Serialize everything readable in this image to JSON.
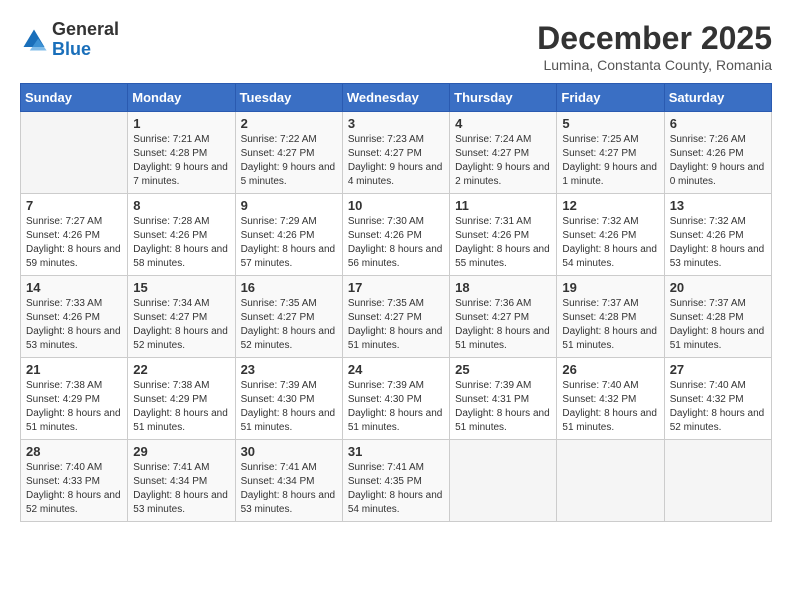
{
  "header": {
    "logo": {
      "general": "General",
      "blue": "Blue"
    },
    "title": "December 2025",
    "location": "Lumina, Constanta County, Romania"
  },
  "calendar": {
    "days_of_week": [
      "Sunday",
      "Monday",
      "Tuesday",
      "Wednesday",
      "Thursday",
      "Friday",
      "Saturday"
    ],
    "weeks": [
      [
        {
          "day": "",
          "sunrise": "",
          "sunset": "",
          "daylight": ""
        },
        {
          "day": "1",
          "sunrise": "Sunrise: 7:21 AM",
          "sunset": "Sunset: 4:28 PM",
          "daylight": "Daylight: 9 hours and 7 minutes."
        },
        {
          "day": "2",
          "sunrise": "Sunrise: 7:22 AM",
          "sunset": "Sunset: 4:27 PM",
          "daylight": "Daylight: 9 hours and 5 minutes."
        },
        {
          "day": "3",
          "sunrise": "Sunrise: 7:23 AM",
          "sunset": "Sunset: 4:27 PM",
          "daylight": "Daylight: 9 hours and 4 minutes."
        },
        {
          "day": "4",
          "sunrise": "Sunrise: 7:24 AM",
          "sunset": "Sunset: 4:27 PM",
          "daylight": "Daylight: 9 hours and 2 minutes."
        },
        {
          "day": "5",
          "sunrise": "Sunrise: 7:25 AM",
          "sunset": "Sunset: 4:27 PM",
          "daylight": "Daylight: 9 hours and 1 minute."
        },
        {
          "day": "6",
          "sunrise": "Sunrise: 7:26 AM",
          "sunset": "Sunset: 4:26 PM",
          "daylight": "Daylight: 9 hours and 0 minutes."
        }
      ],
      [
        {
          "day": "7",
          "sunrise": "Sunrise: 7:27 AM",
          "sunset": "Sunset: 4:26 PM",
          "daylight": "Daylight: 8 hours and 59 minutes."
        },
        {
          "day": "8",
          "sunrise": "Sunrise: 7:28 AM",
          "sunset": "Sunset: 4:26 PM",
          "daylight": "Daylight: 8 hours and 58 minutes."
        },
        {
          "day": "9",
          "sunrise": "Sunrise: 7:29 AM",
          "sunset": "Sunset: 4:26 PM",
          "daylight": "Daylight: 8 hours and 57 minutes."
        },
        {
          "day": "10",
          "sunrise": "Sunrise: 7:30 AM",
          "sunset": "Sunset: 4:26 PM",
          "daylight": "Daylight: 8 hours and 56 minutes."
        },
        {
          "day": "11",
          "sunrise": "Sunrise: 7:31 AM",
          "sunset": "Sunset: 4:26 PM",
          "daylight": "Daylight: 8 hours and 55 minutes."
        },
        {
          "day": "12",
          "sunrise": "Sunrise: 7:32 AM",
          "sunset": "Sunset: 4:26 PM",
          "daylight": "Daylight: 8 hours and 54 minutes."
        },
        {
          "day": "13",
          "sunrise": "Sunrise: 7:32 AM",
          "sunset": "Sunset: 4:26 PM",
          "daylight": "Daylight: 8 hours and 53 minutes."
        }
      ],
      [
        {
          "day": "14",
          "sunrise": "Sunrise: 7:33 AM",
          "sunset": "Sunset: 4:26 PM",
          "daylight": "Daylight: 8 hours and 53 minutes."
        },
        {
          "day": "15",
          "sunrise": "Sunrise: 7:34 AM",
          "sunset": "Sunset: 4:27 PM",
          "daylight": "Daylight: 8 hours and 52 minutes."
        },
        {
          "day": "16",
          "sunrise": "Sunrise: 7:35 AM",
          "sunset": "Sunset: 4:27 PM",
          "daylight": "Daylight: 8 hours and 52 minutes."
        },
        {
          "day": "17",
          "sunrise": "Sunrise: 7:35 AM",
          "sunset": "Sunset: 4:27 PM",
          "daylight": "Daylight: 8 hours and 51 minutes."
        },
        {
          "day": "18",
          "sunrise": "Sunrise: 7:36 AM",
          "sunset": "Sunset: 4:27 PM",
          "daylight": "Daylight: 8 hours and 51 minutes."
        },
        {
          "day": "19",
          "sunrise": "Sunrise: 7:37 AM",
          "sunset": "Sunset: 4:28 PM",
          "daylight": "Daylight: 8 hours and 51 minutes."
        },
        {
          "day": "20",
          "sunrise": "Sunrise: 7:37 AM",
          "sunset": "Sunset: 4:28 PM",
          "daylight": "Daylight: 8 hours and 51 minutes."
        }
      ],
      [
        {
          "day": "21",
          "sunrise": "Sunrise: 7:38 AM",
          "sunset": "Sunset: 4:29 PM",
          "daylight": "Daylight: 8 hours and 51 minutes."
        },
        {
          "day": "22",
          "sunrise": "Sunrise: 7:38 AM",
          "sunset": "Sunset: 4:29 PM",
          "daylight": "Daylight: 8 hours and 51 minutes."
        },
        {
          "day": "23",
          "sunrise": "Sunrise: 7:39 AM",
          "sunset": "Sunset: 4:30 PM",
          "daylight": "Daylight: 8 hours and 51 minutes."
        },
        {
          "day": "24",
          "sunrise": "Sunrise: 7:39 AM",
          "sunset": "Sunset: 4:30 PM",
          "daylight": "Daylight: 8 hours and 51 minutes."
        },
        {
          "day": "25",
          "sunrise": "Sunrise: 7:39 AM",
          "sunset": "Sunset: 4:31 PM",
          "daylight": "Daylight: 8 hours and 51 minutes."
        },
        {
          "day": "26",
          "sunrise": "Sunrise: 7:40 AM",
          "sunset": "Sunset: 4:32 PM",
          "daylight": "Daylight: 8 hours and 51 minutes."
        },
        {
          "day": "27",
          "sunrise": "Sunrise: 7:40 AM",
          "sunset": "Sunset: 4:32 PM",
          "daylight": "Daylight: 8 hours and 52 minutes."
        }
      ],
      [
        {
          "day": "28",
          "sunrise": "Sunrise: 7:40 AM",
          "sunset": "Sunset: 4:33 PM",
          "daylight": "Daylight: 8 hours and 52 minutes."
        },
        {
          "day": "29",
          "sunrise": "Sunrise: 7:41 AM",
          "sunset": "Sunset: 4:34 PM",
          "daylight": "Daylight: 8 hours and 53 minutes."
        },
        {
          "day": "30",
          "sunrise": "Sunrise: 7:41 AM",
          "sunset": "Sunset: 4:34 PM",
          "daylight": "Daylight: 8 hours and 53 minutes."
        },
        {
          "day": "31",
          "sunrise": "Sunrise: 7:41 AM",
          "sunset": "Sunset: 4:35 PM",
          "daylight": "Daylight: 8 hours and 54 minutes."
        },
        {
          "day": "",
          "sunrise": "",
          "sunset": "",
          "daylight": ""
        },
        {
          "day": "",
          "sunrise": "",
          "sunset": "",
          "daylight": ""
        },
        {
          "day": "",
          "sunrise": "",
          "sunset": "",
          "daylight": ""
        }
      ]
    ]
  }
}
